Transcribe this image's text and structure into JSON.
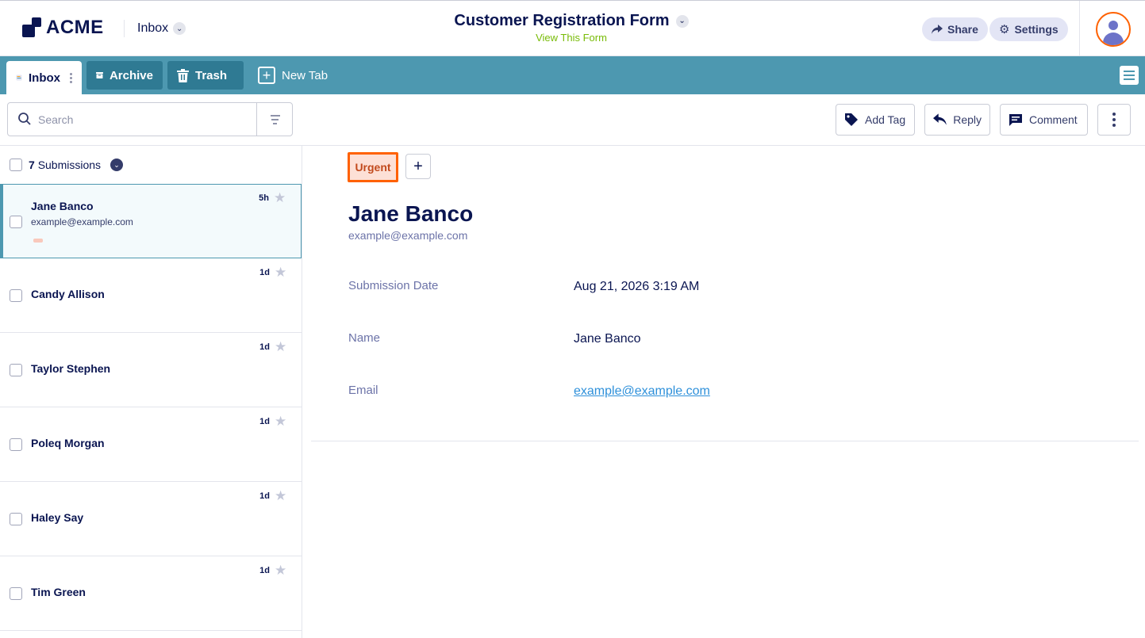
{
  "header": {
    "logo_text": "ACME",
    "inbox_label": "Inbox",
    "form_title": "Customer Registration Form",
    "view_form_link": "View This Form",
    "share_label": "Share",
    "settings_label": "Settings"
  },
  "tabs": {
    "inbox": "Inbox",
    "archive": "Archive",
    "trash": "Trash",
    "new_tab": "New Tab"
  },
  "toolbar": {
    "search_placeholder": "Search",
    "add_tag": "Add Tag",
    "reply": "Reply",
    "comment": "Comment"
  },
  "list": {
    "count": "7",
    "count_label": "Submissions",
    "items": [
      {
        "name": "Jane Banco",
        "email": "example@example.com",
        "time": "5h"
      },
      {
        "name": "Candy Allison",
        "time": "1d"
      },
      {
        "name": "Taylor Stephen",
        "time": "1d"
      },
      {
        "name": "Poleq Morgan",
        "time": "1d"
      },
      {
        "name": "Haley Say",
        "time": "1d"
      },
      {
        "name": "Tim Green",
        "time": "1d"
      }
    ]
  },
  "detail": {
    "tag": "Urgent",
    "add_tag_symbol": "+",
    "name": "Jane Banco",
    "email": "example@example.com",
    "fields": [
      {
        "label": "Submission Date",
        "value": "Aug 21, 2026 3:19 AM"
      },
      {
        "label": "Name",
        "value": "Jane Banco"
      },
      {
        "label": "Email",
        "value": "example@example.com"
      }
    ]
  },
  "colors": {
    "brand_navy": "#0a1551",
    "tabbar": "#4d98b0",
    "urgent_border": "#ff6100",
    "link": "#2e90da",
    "view_form_green": "#78bb07"
  },
  "icons": [
    "acme-logo-icon",
    "chevron-down-icon",
    "share-icon",
    "gear-icon",
    "user-avatar-icon",
    "inbox-tab-icon",
    "archive-icon",
    "trash-icon",
    "plus-icon",
    "hamburger-menu-icon",
    "search-icon",
    "filter-icon",
    "tag-icon",
    "reply-icon",
    "comment-icon",
    "kebab-icon",
    "star-icon"
  ]
}
